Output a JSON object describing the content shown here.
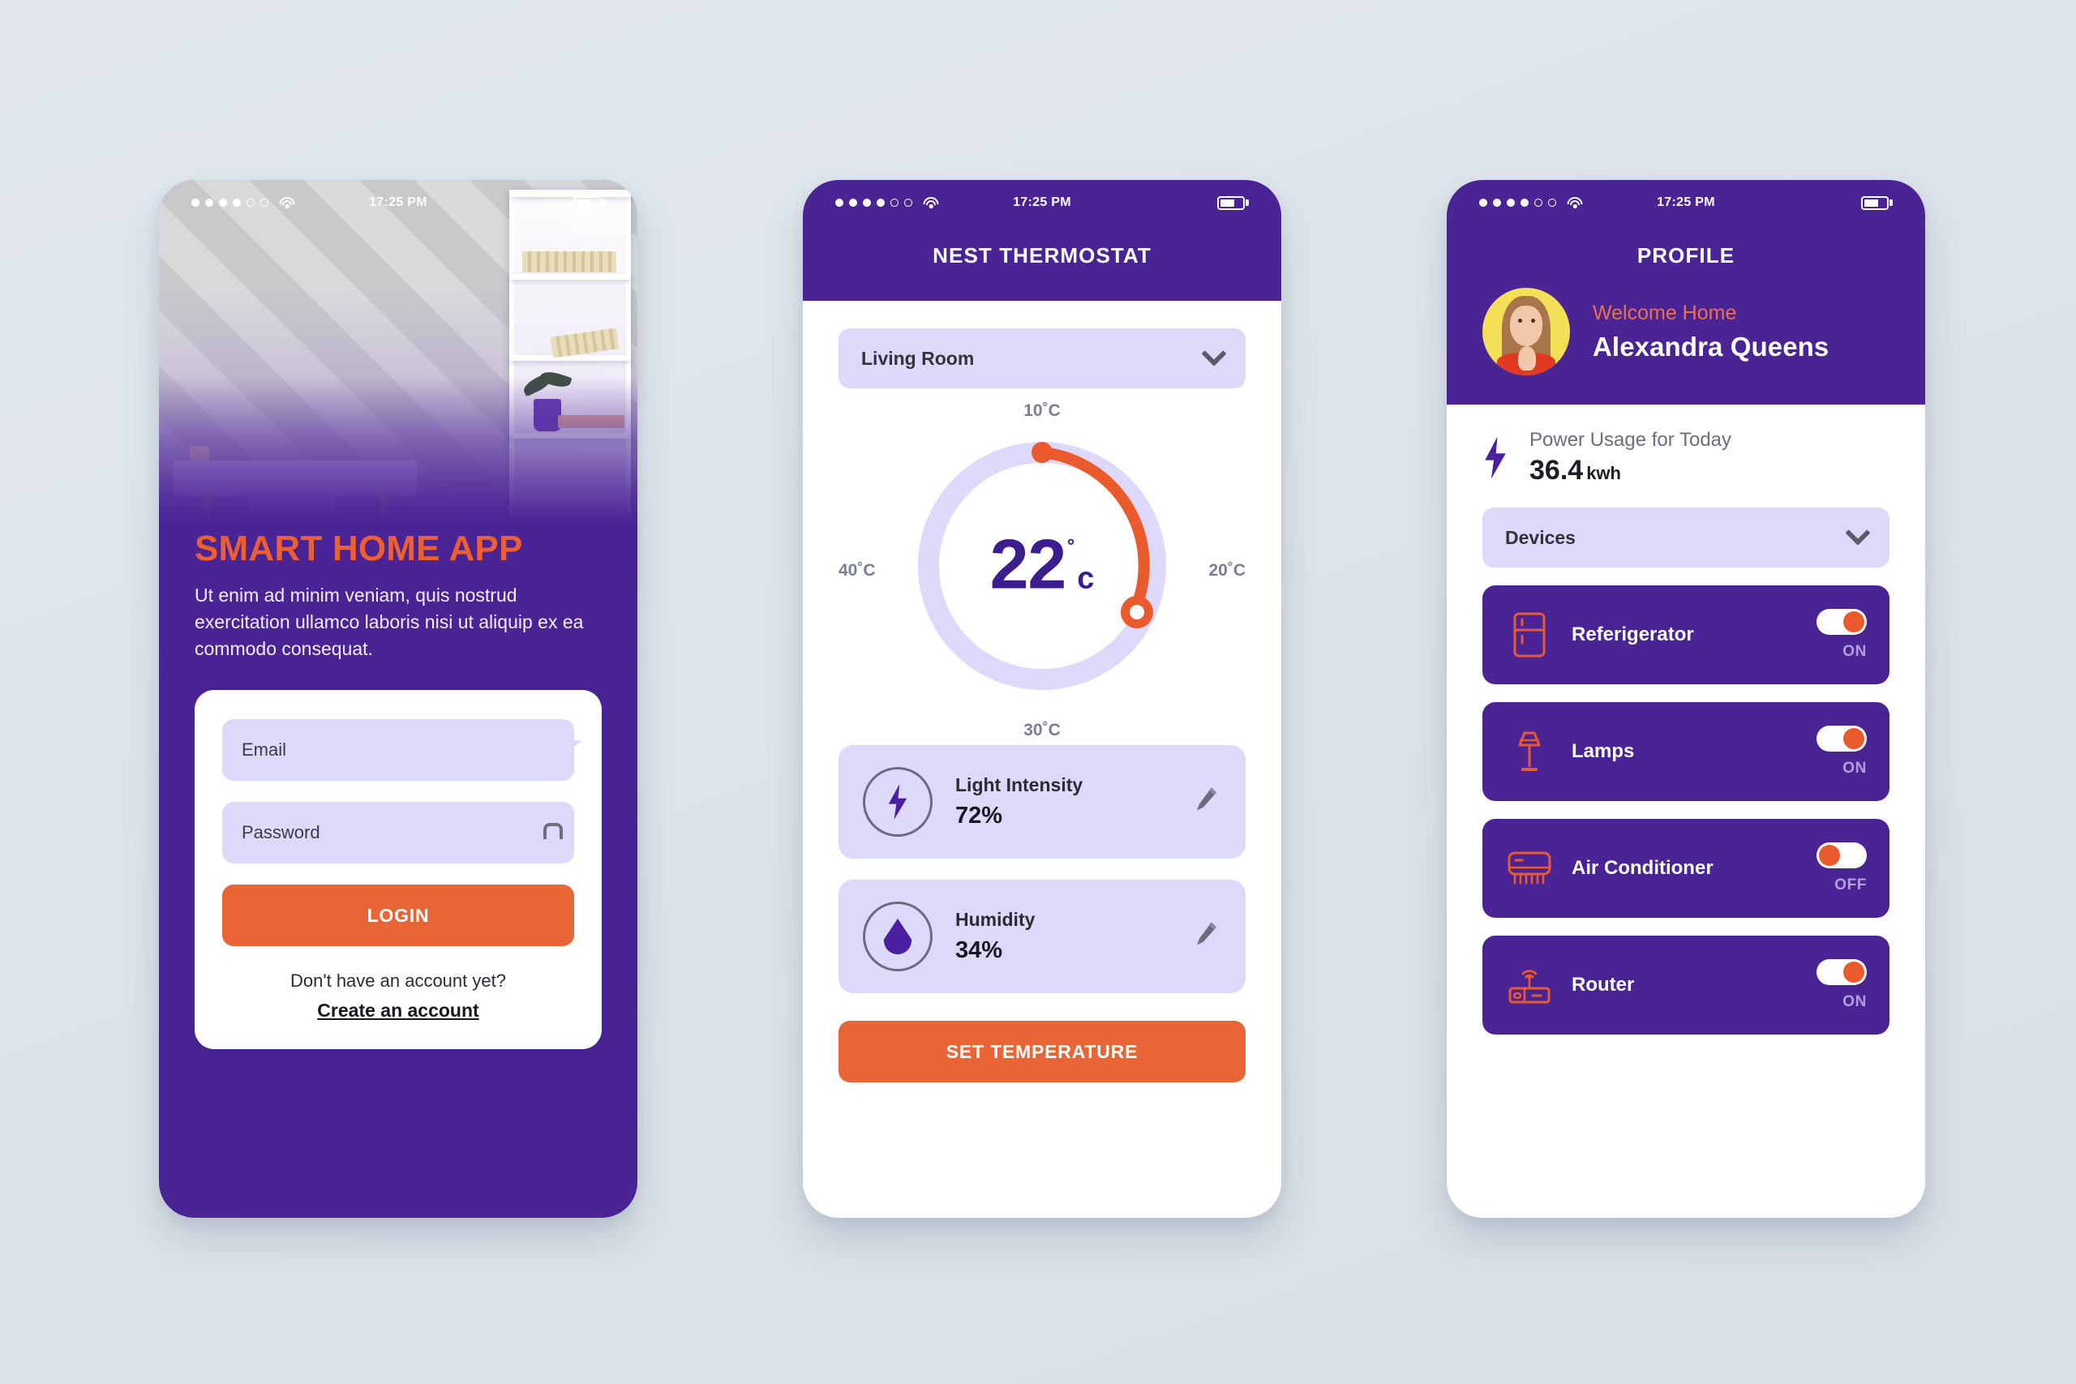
{
  "colors": {
    "background": "#dde4ea",
    "purple": "#4a2495",
    "deep_purple": "#3c1d8e",
    "orange": "#ea6536",
    "lavender": "#ddd9fb",
    "yellow": "#f3e057"
  },
  "status_bar": {
    "time": "17:25 PM",
    "signal_dots_filled": 4,
    "signal_dots_empty": 2
  },
  "login_screen": {
    "title": "SMART HOME APP",
    "description": "Ut enim ad minim veniam, quis nostrud exercitation ullamco laboris nisi ut aliquip ex ea commodo consequat.",
    "email_placeholder": "Email",
    "password_placeholder": "Password",
    "email_icon": "envelope-icon",
    "password_icon": "lock-icon",
    "login_label": "LOGIN",
    "footer_question": "Don't have an account yet?",
    "footer_action": "Create an account"
  },
  "thermostat_screen": {
    "header_title": "NEST THERMOSTAT",
    "room_selected": "Living Room",
    "room_chevron_icon": "chevron-down-icon",
    "dial": {
      "top_label": "10˚C",
      "right_label": "20˚C",
      "bottom_label": "30˚C",
      "left_label": "40˚C",
      "current_value": "22",
      "degree_symbol": "˚",
      "unit": "c"
    },
    "stats": [
      {
        "icon": "bolt-icon",
        "name": "Light Intensity",
        "value": "72%",
        "edit_icon": "pencil-icon"
      },
      {
        "icon": "water-drop-icon",
        "name": "Humidity",
        "value": "34%",
        "edit_icon": "pencil-icon"
      }
    ],
    "set_button_label": "SET TEMPERATURE"
  },
  "profile_screen": {
    "header_title": "PROFILE",
    "avatar_icon": "user-avatar",
    "welcome_text": "Welcome Home",
    "user_name": "Alexandra Queens",
    "power": {
      "icon": "bolt-icon",
      "label": "Power Usage for Today",
      "value": "36.4",
      "unit": "kwh"
    },
    "devices_select": "Devices",
    "devices_chevron_icon": "chevron-down-icon",
    "devices": [
      {
        "icon": "refrigerator-icon",
        "name": "Referigerator",
        "state": "ON",
        "on": true
      },
      {
        "icon": "lamp-icon",
        "name": "Lamps",
        "state": "ON",
        "on": true
      },
      {
        "icon": "air-conditioner-icon",
        "name": "Air Conditioner",
        "state": "OFF",
        "on": false
      },
      {
        "icon": "router-icon",
        "name": "Router",
        "state": "ON",
        "on": true
      }
    ]
  },
  "chart_data": {
    "type": "pie",
    "title": "Temperature dial",
    "categories": [
      "10˚C",
      "20˚C",
      "30˚C",
      "40˚C"
    ],
    "values": [
      10,
      20,
      30,
      40
    ],
    "current": 22,
    "arc_start_deg": 0,
    "arc_sweep_deg": 125,
    "axis_labels_position": "around-circle"
  }
}
